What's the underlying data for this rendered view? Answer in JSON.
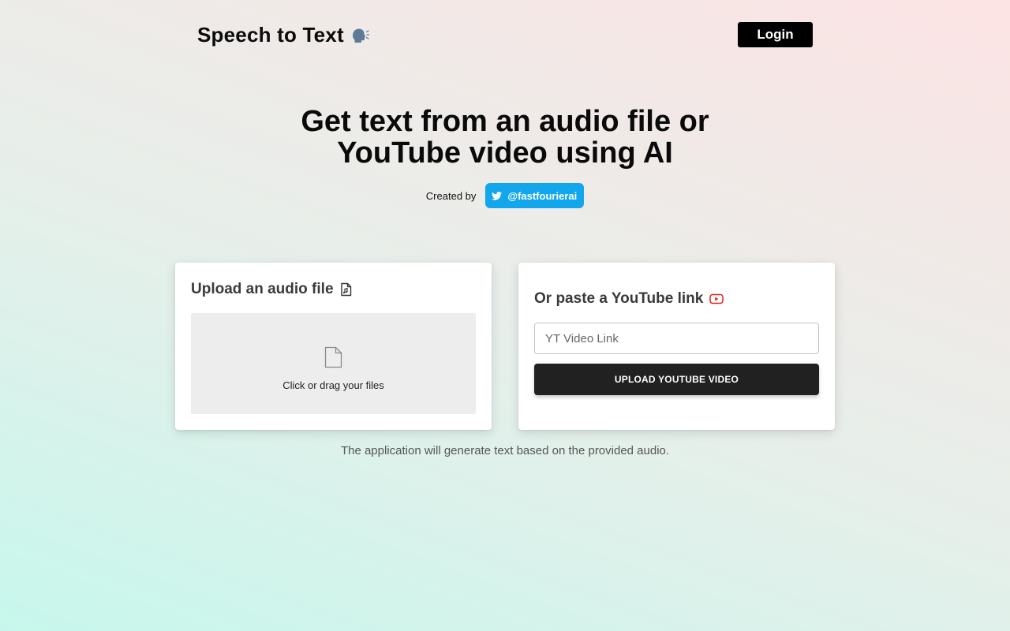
{
  "header": {
    "brand": "Speech to Text",
    "brand_icon": "speaking-head-icon",
    "login_label": "Login"
  },
  "hero": {
    "title_line1": "Get text from an audio file or",
    "title_line2": "YouTube video using AI",
    "created_by": "Created by",
    "twitter_handle": "@fastfourierai",
    "twitter_icon": "twitter-bird-icon"
  },
  "upload_card": {
    "title": "Upload an audio file",
    "title_icon": "audio-file-icon",
    "dropzone_icon": "file-icon",
    "dropzone_text": "Click or drag your files"
  },
  "youtube_card": {
    "title": "Or paste a YouTube link",
    "title_icon": "youtube-icon",
    "input_value": "",
    "input_placeholder": "YT Video Link",
    "button_label": "UPLOAD YOUTUBE VIDEO"
  },
  "footnote": "The application will generate text based on the provided audio.",
  "colors": {
    "twitter_blue": "#12a6ec",
    "youtube_red": "#e62117",
    "dark_button": "#212121"
  }
}
